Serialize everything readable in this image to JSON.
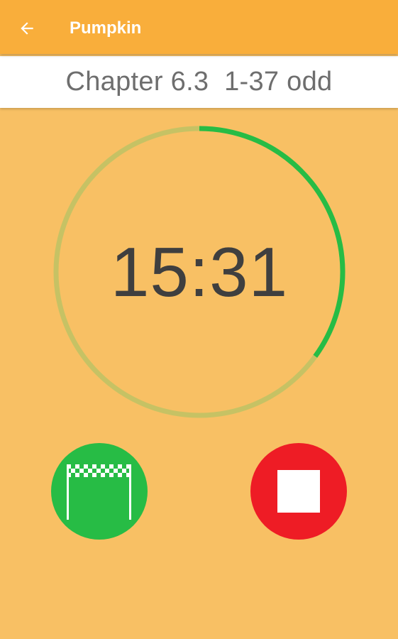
{
  "appbar": {
    "title": "Pumpkin",
    "back_icon": "arrow-back-icon"
  },
  "assignment": {
    "label": "Chapter 6.3  1-37 odd"
  },
  "timer": {
    "display": "15:31",
    "progress_fraction": 0.35,
    "colors": {
      "track": "#C6C264",
      "progress": "#27BC45"
    }
  },
  "actions": {
    "finish_icon": "checkered-finish-flag-icon",
    "stop_icon": "stop-icon",
    "colors": {
      "finish": "#27BC45",
      "stop": "#EE1C25"
    }
  },
  "theme": {
    "background": "#F8C064",
    "appbar": "#F9AE3B"
  }
}
